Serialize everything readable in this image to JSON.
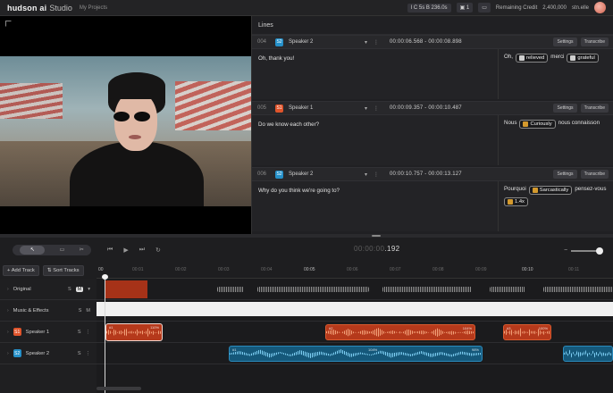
{
  "topbar": {
    "logo": "hudson ai",
    "logo_sub": "Studio",
    "projects": "My Projects",
    "info": "I C 5s B 236.0s",
    "badge1": "▣ 1",
    "remaining_label": "Remaining Credit",
    "remaining_value": "2,400,000",
    "user": "stn.elle"
  },
  "lines": {
    "title": "Lines",
    "settings_label": "Settings",
    "transcribe_label": "Transcribe",
    "items": [
      {
        "num": "004",
        "speaker": "Speaker 2",
        "speaker_badge": "S2",
        "timecode": "00:00:06.568 - 00:00:08.898",
        "source": "Oh, thank you!",
        "target_pre": "Oh,",
        "emotion1": "relieved",
        "target_mid": "merci",
        "emotion2": "grateful"
      },
      {
        "num": "005",
        "speaker": "Speaker 1",
        "speaker_badge": "S1",
        "timecode": "00:00:09.357 - 00:00:10.487",
        "source": "Do we know each other?",
        "target_pre": "Nous",
        "emotion1": "Curiously",
        "target_post": "nous connaisson"
      },
      {
        "num": "006",
        "speaker": "Speaker 2",
        "speaker_badge": "S2",
        "timecode": "00:00:10.757 - 00:00:13.127",
        "source": "Why do you think we're going to?",
        "target_pre": "Pourquoi",
        "emotion1": "Sarcastically",
        "target_post": "pensez-vous",
        "speed": "1.4x"
      }
    ]
  },
  "transport": {
    "time_dim": "00:00:00",
    "time_bright": ".192",
    "prev_icon": "skip-back-icon",
    "play_icon": "play-icon",
    "next_icon": "skip-forward-icon"
  },
  "timeline": {
    "add_track": "Add Track",
    "sort_tracks": "Sort Tracks",
    "ticks": [
      "00",
      "00:01",
      "00:02",
      "00:03",
      "00:04",
      "00:05",
      "00:06",
      "00:07",
      "00:08",
      "00:09",
      "00:10",
      "00:11"
    ],
    "tracks": [
      {
        "label": "Original",
        "m": "M"
      },
      {
        "label": "Music & Effects"
      },
      {
        "label": "Speaker 1",
        "badge": "S1"
      },
      {
        "label": "Speaker 2",
        "badge": "S2"
      }
    ],
    "clips": {
      "s1_a_label": "#1",
      "s1_a_pct": "110%",
      "s1_b_label": "#2",
      "s1_b_pct": "104%",
      "s1_c_label": "#3",
      "s1_c_pct": "100%",
      "s2_a_label": "#1",
      "s2_a_pct": "104%",
      "s2_b_pct": "98%"
    }
  },
  "colors": {
    "speaker1": "#e0542b",
    "speaker2": "#2590c9"
  }
}
